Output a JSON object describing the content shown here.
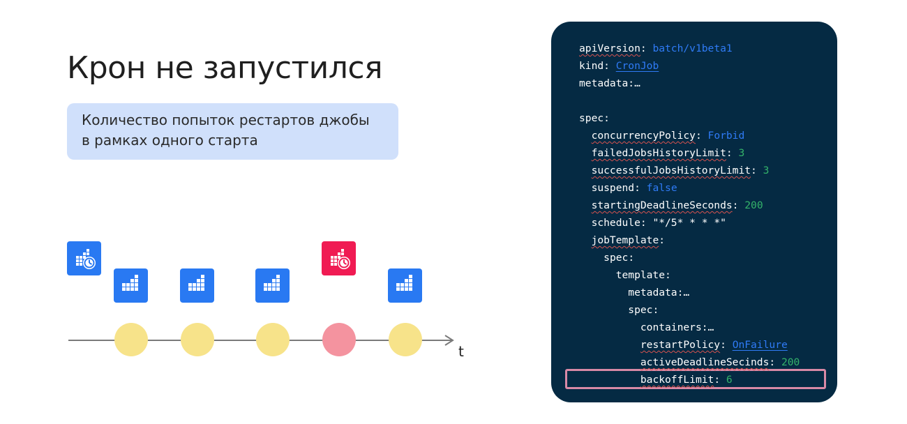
{
  "title": "Крон не запустился",
  "subtitle": "Количество попыток рестартов джобы\nв рамках одного старта",
  "timeline": {
    "axis_label": "t",
    "runs": [
      {
        "status": "ok"
      },
      {
        "status": "ok"
      },
      {
        "status": "ok"
      },
      {
        "status": "failed"
      },
      {
        "status": "ok"
      }
    ]
  },
  "icons": {
    "cronjob": "cronjob-icon",
    "job": "job-icon"
  },
  "colors": {
    "tile_blue": "#2979f2",
    "tile_red": "#f01b53",
    "node_ok": "#f7e38a",
    "node_failed": "#f4939f",
    "panel_bg": "#052a43",
    "value_blue": "#2f7bf6",
    "value_green": "#34b36a",
    "highlight": "#d889a6"
  },
  "code": {
    "lines": [
      {
        "indent": 0,
        "key": "apiVersion",
        "underline": true,
        "sep": ": ",
        "value": "batch/v1beta1",
        "vtype": "str"
      },
      {
        "indent": 0,
        "key": "kind",
        "underline": false,
        "sep": ": ",
        "value": "CronJob",
        "vtype": "link"
      },
      {
        "indent": 0,
        "key": "metadata",
        "underline": false,
        "sep": ":…",
        "value": "",
        "vtype": ""
      },
      {
        "indent": 0,
        "key": "",
        "underline": false,
        "sep": "",
        "value": "",
        "vtype": ""
      },
      {
        "indent": 0,
        "key": "spec",
        "underline": false,
        "sep": ":",
        "value": "",
        "vtype": ""
      },
      {
        "indent": 1,
        "key": "concurrencyPolicy",
        "underline": true,
        "sep": ": ",
        "value": "Forbid",
        "vtype": "str"
      },
      {
        "indent": 1,
        "key": "failedJobsHistoryLimit",
        "underline": true,
        "sep": ": ",
        "value": "3",
        "vtype": "num"
      },
      {
        "indent": 1,
        "key": "successfulJobsHistoryLimit",
        "underline": true,
        "sep": ": ",
        "value": "3",
        "vtype": "num"
      },
      {
        "indent": 1,
        "key": "suspend",
        "underline": false,
        "sep": ": ",
        "value": "false",
        "vtype": "str"
      },
      {
        "indent": 1,
        "key": "startingDeadlineSeconds",
        "underline": true,
        "sep": ": ",
        "value": "200",
        "vtype": "num"
      },
      {
        "indent": 1,
        "key": "schedule",
        "underline": false,
        "sep": ": ",
        "value": "\"*/5* * * *\"",
        "vtype": "plain"
      },
      {
        "indent": 1,
        "key": "jobTemplate",
        "underline": true,
        "sep": ":",
        "value": "",
        "vtype": ""
      },
      {
        "indent": 2,
        "key": "spec",
        "underline": false,
        "sep": ":",
        "value": "",
        "vtype": ""
      },
      {
        "indent": 3,
        "key": "template",
        "underline": false,
        "sep": ":",
        "value": "",
        "vtype": ""
      },
      {
        "indent": 4,
        "key": "metadata",
        "underline": false,
        "sep": ":…",
        "value": "",
        "vtype": ""
      },
      {
        "indent": 4,
        "key": "spec",
        "underline": false,
        "sep": ":",
        "value": "",
        "vtype": ""
      },
      {
        "indent": 5,
        "key": "containers",
        "underline": false,
        "sep": ":…",
        "value": "",
        "vtype": ""
      },
      {
        "indent": 5,
        "key": "restartPolicy",
        "underline": true,
        "sep": ": ",
        "value": "OnFailure",
        "vtype": "link"
      },
      {
        "indent": 5,
        "key": "activeDeadlineSecinds",
        "underline": true,
        "sep": ": ",
        "value": "200",
        "vtype": "num"
      },
      {
        "indent": 5,
        "key": "backoffLimit",
        "underline": true,
        "sep": ": ",
        "value": "6",
        "vtype": "num"
      }
    ],
    "highlighted_key": "backoffLimit"
  }
}
